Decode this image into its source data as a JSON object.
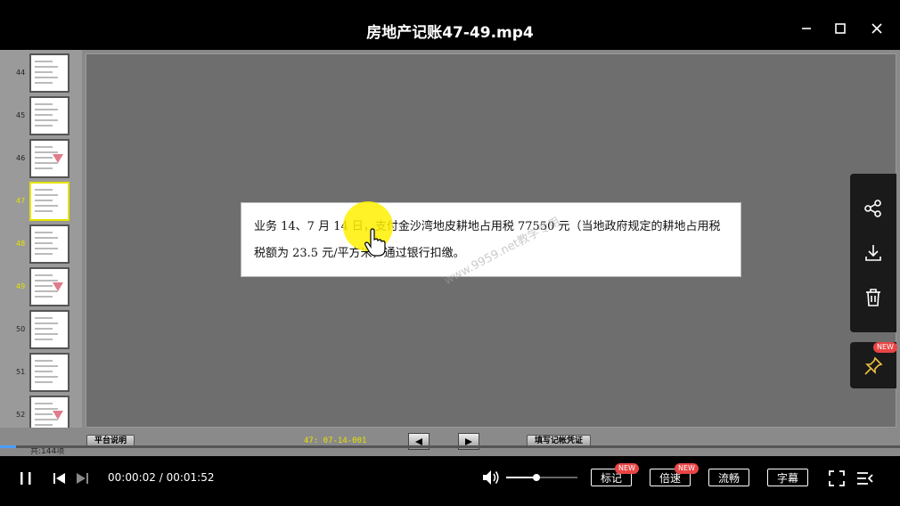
{
  "window": {
    "title": "房地产记账47-49.mp4"
  },
  "thumbnails": [
    {
      "num": "44",
      "highlight": false,
      "selected": false
    },
    {
      "num": "45",
      "highlight": false,
      "selected": false
    },
    {
      "num": "46",
      "highlight": false,
      "selected": false
    },
    {
      "num": "47",
      "highlight": true,
      "selected": true
    },
    {
      "num": "48",
      "highlight": true,
      "selected": false
    },
    {
      "num": "49",
      "highlight": true,
      "selected": false
    },
    {
      "num": "50",
      "highlight": false,
      "selected": false
    },
    {
      "num": "51",
      "highlight": false,
      "selected": false
    },
    {
      "num": "52",
      "highlight": false,
      "selected": false
    }
  ],
  "slide": {
    "line1": "业务 14、7 月 14 日，支付金沙湾地皮耕地占用税 77550 元（当地政府规定的耕地占用税",
    "line2": "税额为 23.5 元/平方米，通过银行扣缴。",
    "watermark": "www.9959.net教学专用",
    "page_count": "共:144项",
    "platform_button": "平台说明",
    "code": "47: 07-14-001",
    "voucher_button": "填写记帐凭证",
    "progress_fraction": 0.018
  },
  "side_panel": {
    "pin_badge": "NEW"
  },
  "controls": {
    "current_time": "00:00:02",
    "total_time": "00:01:52",
    "time_text": "00:00:02 / 00:01:52",
    "volume_fraction": 0.42,
    "mark_label": "标记",
    "mark_badge": "NEW",
    "speed_label": "倍速",
    "speed_badge": "NEW",
    "quality_label": "流畅",
    "subtitle_label": "字幕"
  },
  "icons": [
    "minimize-icon",
    "maximize-icon",
    "close-icon",
    "share-icon",
    "download-icon",
    "delete-icon",
    "pin-icon",
    "pause-icon",
    "previous-icon",
    "next-icon",
    "volume-icon",
    "fullscreen-icon",
    "playlist-icon",
    "hand-cursor-icon"
  ]
}
